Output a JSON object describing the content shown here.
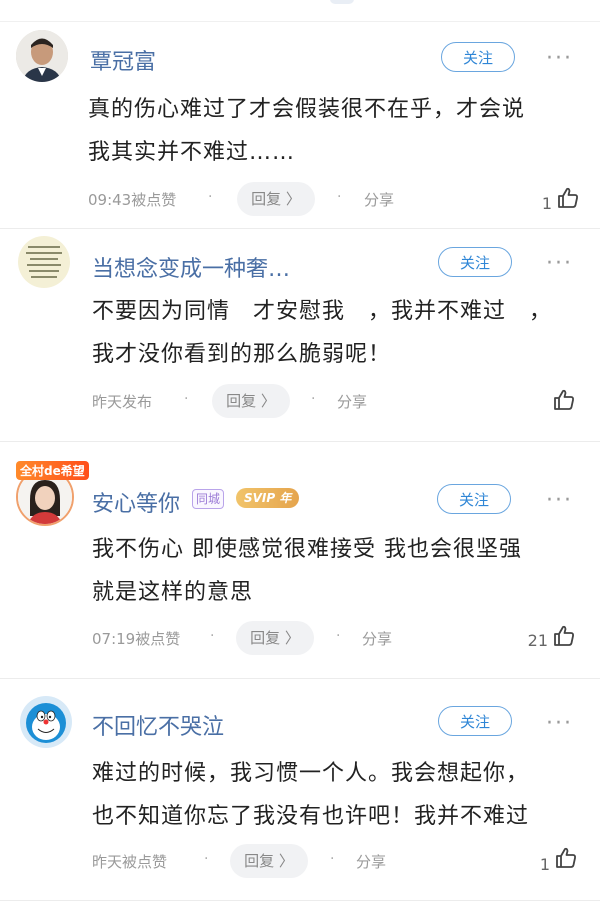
{
  "comments": [
    {
      "username": "覃冠富",
      "follow_label": "关注",
      "text_line1": "真的伤心难过了才会假装很不在乎，才会说",
      "text_line2": "我其实并不难过……",
      "time_label": "09:43被点赞",
      "reply_label": "回复 〉",
      "share_label": "分享",
      "like_count": "1",
      "more_label": "···"
    },
    {
      "username": "当想念变成一种奢…",
      "follow_label": "关注",
      "text_line1": "不要因为同情　才安慰我　，我并不难过　，",
      "text_line2": "我才没你看到的那么脆弱呢！",
      "time_label": "昨天发布",
      "reply_label": "回复 〉",
      "share_label": "分享",
      "like_count": "",
      "more_label": "···"
    },
    {
      "username": "安心等你",
      "banner_label": "全村de希望",
      "city_badge": "同城",
      "svip_badge": "SVIP 年",
      "follow_label": "关注",
      "text_line1": "我不伤心 即使感觉很难接受 我也会很坚强",
      "text_line2": "就是这样的意思",
      "time_label": "07:19被点赞",
      "reply_label": "回复 〉",
      "share_label": "分享",
      "like_count": "21",
      "more_label": "···"
    },
    {
      "username": "不回忆不哭泣",
      "follow_label": "关注",
      "text_line1": "难过的时候，我习惯一个人。我会想起你，",
      "text_line2": "也不知道你忘了我没有也许吧！我并不难过",
      "time_label": "昨天被点赞",
      "reply_label": "回复 〉",
      "share_label": "分享",
      "like_count": "1",
      "more_label": "···"
    }
  ],
  "colors": {
    "username": "#4a6fa5",
    "follow_border": "#6aa6df",
    "follow_text": "#2f86d6",
    "meta": "#9a9a9a"
  }
}
